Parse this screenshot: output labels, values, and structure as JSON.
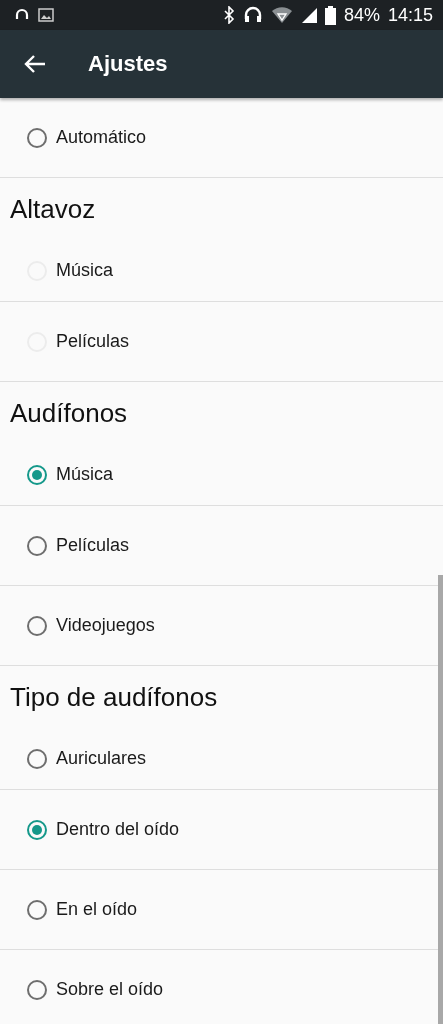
{
  "status_bar": {
    "battery": "84%",
    "time": "14:15"
  },
  "app_bar": {
    "title": "Ajustes"
  },
  "sections": [
    {
      "items": [
        {
          "label": "Automático",
          "selected": false,
          "disabled": false
        }
      ]
    },
    {
      "title": "Altavoz",
      "items": [
        {
          "label": "Música",
          "selected": false,
          "disabled": true
        },
        {
          "label": "Películas",
          "selected": false,
          "disabled": true
        }
      ]
    },
    {
      "title": "Audífonos",
      "items": [
        {
          "label": "Música",
          "selected": true,
          "disabled": false
        },
        {
          "label": "Películas",
          "selected": false,
          "disabled": false
        },
        {
          "label": "Videojuegos",
          "selected": false,
          "disabled": false
        }
      ]
    },
    {
      "title": "Tipo de audífonos",
      "items": [
        {
          "label": "Auriculares",
          "selected": false,
          "disabled": false
        },
        {
          "label": "Dentro del oído",
          "selected": true,
          "disabled": false
        },
        {
          "label": "En el oído",
          "selected": false,
          "disabled": false
        },
        {
          "label": "Sobre el oído",
          "selected": false,
          "disabled": false
        }
      ]
    }
  ]
}
